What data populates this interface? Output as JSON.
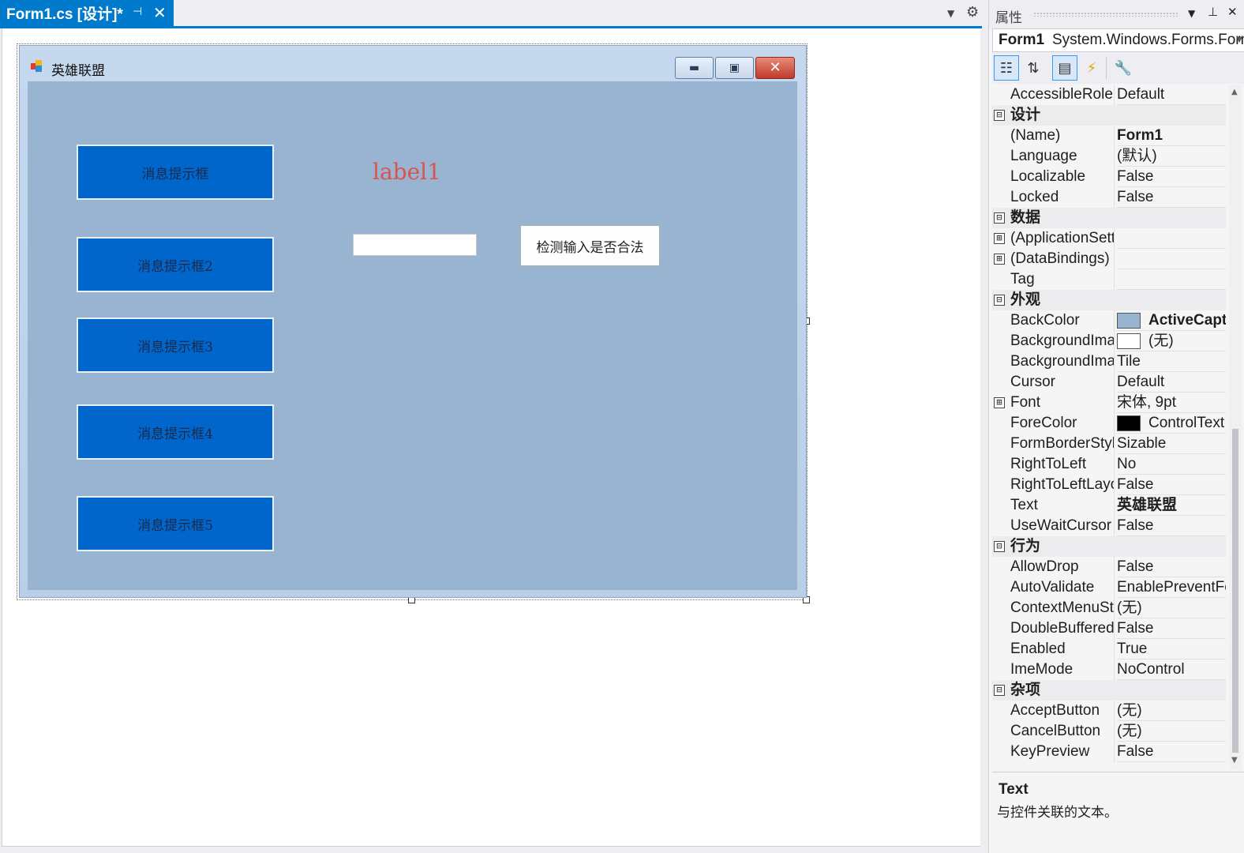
{
  "document_tab": {
    "title": "Form1.cs [设计]*",
    "pin_icon": "pin-icon",
    "close_icon": "close-icon"
  },
  "form": {
    "title": "英雄联盟",
    "buttons": [
      "消息提示框",
      "消息提示框2",
      "消息提示框3",
      "消息提示框4",
      "消息提示框5"
    ],
    "label1": "label1",
    "textbox_value": "",
    "check_button": "检测输入是否合法",
    "client_color": "#99b4d1",
    "button_color": "#0066cc"
  },
  "properties": {
    "header_title": "属性",
    "object_name": "Form1",
    "object_type": "System.Windows.Forms.Form",
    "rows": [
      {
        "kind": "prop",
        "name": "AccessibleRole",
        "value": "Default"
      },
      {
        "kind": "cat",
        "name": "设计",
        "toggle": "⊟"
      },
      {
        "kind": "prop",
        "name": "(Name)",
        "value": "Form1",
        "bold": true
      },
      {
        "kind": "prop",
        "name": "Language",
        "value": "(默认)"
      },
      {
        "kind": "prop",
        "name": "Localizable",
        "value": "False"
      },
      {
        "kind": "prop",
        "name": "Locked",
        "value": "False"
      },
      {
        "kind": "cat",
        "name": "数据",
        "toggle": "⊟"
      },
      {
        "kind": "prop",
        "name": "(ApplicationSettings)",
        "value": "",
        "toggle": "⊞"
      },
      {
        "kind": "prop",
        "name": "(DataBindings)",
        "value": "",
        "toggle": "⊞"
      },
      {
        "kind": "prop",
        "name": "Tag",
        "value": ""
      },
      {
        "kind": "cat",
        "name": "外观",
        "toggle": "⊟"
      },
      {
        "kind": "prop",
        "name": "BackColor",
        "value": "ActiveCaption",
        "bold": true,
        "swatch": "#99b4d1"
      },
      {
        "kind": "prop",
        "name": "BackgroundImage",
        "value": "(无)",
        "swatch": "#ffffff"
      },
      {
        "kind": "prop",
        "name": "BackgroundImageLayout",
        "value": "Tile"
      },
      {
        "kind": "prop",
        "name": "Cursor",
        "value": "Default"
      },
      {
        "kind": "prop",
        "name": "Font",
        "value": "宋体, 9pt",
        "toggle": "⊞"
      },
      {
        "kind": "prop",
        "name": "ForeColor",
        "value": "ControlText",
        "swatch": "#000000"
      },
      {
        "kind": "prop",
        "name": "FormBorderStyle",
        "value": "Sizable"
      },
      {
        "kind": "prop",
        "name": "RightToLeft",
        "value": "No"
      },
      {
        "kind": "prop",
        "name": "RightToLeftLayout",
        "value": "False"
      },
      {
        "kind": "prop",
        "name": "Text",
        "value": "英雄联盟",
        "bold": true
      },
      {
        "kind": "prop",
        "name": "UseWaitCursor",
        "value": "False"
      },
      {
        "kind": "cat",
        "name": "行为",
        "toggle": "⊟"
      },
      {
        "kind": "prop",
        "name": "AllowDrop",
        "value": "False"
      },
      {
        "kind": "prop",
        "name": "AutoValidate",
        "value": "EnablePreventFocusChange"
      },
      {
        "kind": "prop",
        "name": "ContextMenuStrip",
        "value": "(无)"
      },
      {
        "kind": "prop",
        "name": "DoubleBuffered",
        "value": "False"
      },
      {
        "kind": "prop",
        "name": "Enabled",
        "value": "True"
      },
      {
        "kind": "prop",
        "name": "ImeMode",
        "value": "NoControl"
      },
      {
        "kind": "cat",
        "name": "杂项",
        "toggle": "⊟"
      },
      {
        "kind": "prop",
        "name": "AcceptButton",
        "value": "(无)"
      },
      {
        "kind": "prop",
        "name": "CancelButton",
        "value": "(无)"
      },
      {
        "kind": "prop",
        "name": "KeyPreview",
        "value": "False"
      }
    ],
    "description": {
      "title": "Text",
      "text": "与控件关联的文本。"
    }
  },
  "accent_color": "#007acc"
}
